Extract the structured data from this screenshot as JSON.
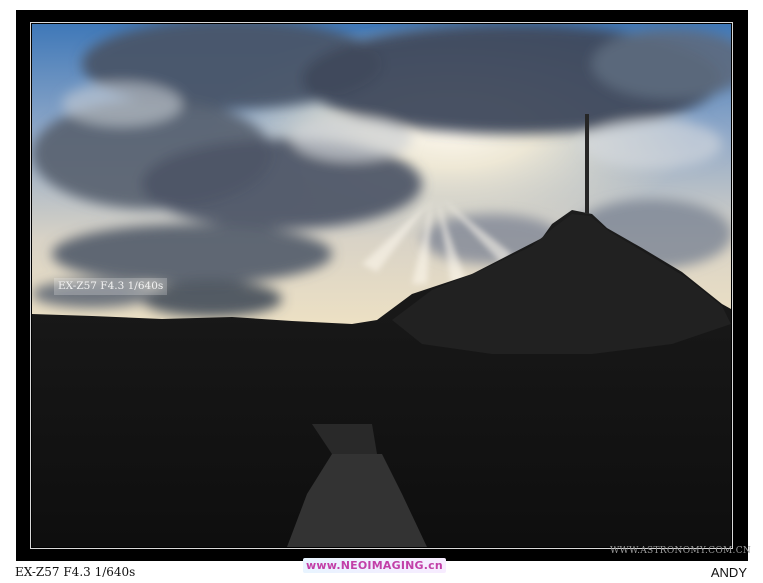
{
  "photo": {
    "overlay_exif": "EX-Z57 F4.3 1/640s",
    "watermark_site": "WWW.ASTRONOMY.COM.CN"
  },
  "caption": {
    "exif": "EX-Z57 F4.3 1/640s",
    "site": "www.NEOIMAGING.cn",
    "author": "ANDY"
  },
  "colors": {
    "frame": "#000000",
    "sky_top": "#3f78b8",
    "sunburst": "#fff6d8",
    "ground": "#141414",
    "caption_site": "#c23fa8"
  }
}
